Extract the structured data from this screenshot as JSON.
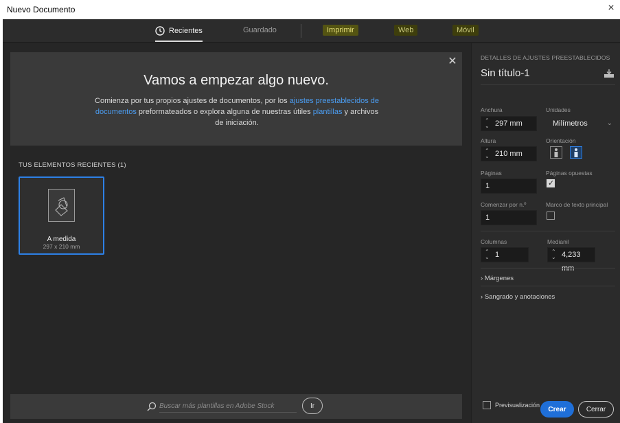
{
  "window": {
    "title": "Nuevo Documento",
    "close_glyph": "×"
  },
  "nav": {
    "tabs": [
      {
        "label": "Recientes"
      },
      {
        "label": "Guardado"
      },
      {
        "label": "Imprimir"
      },
      {
        "label": "Web"
      },
      {
        "label": "Móvil"
      }
    ]
  },
  "hero": {
    "title": "Vamos a empezar algo nuevo.",
    "text_1": "Comienza por tus propios ajustes de documentos, por los ",
    "link_1": "ajustes preestablecidos de documentos",
    "text_2": " preformateados o explora alguna de nuestras útiles ",
    "link_2": "plantillas",
    "text_3": " y archivos de iniciación.",
    "close_glyph": "✕"
  },
  "recent": {
    "label": "TUS ELEMENTOS RECIENTES  (1)",
    "items": [
      {
        "name": "A medida",
        "size": "297 x 210 mm"
      }
    ]
  },
  "search": {
    "placeholder": "Buscar más plantillas en Adobe Stock",
    "button": "Ir"
  },
  "panel": {
    "header": "DETALLES DE AJUSTES PREESTABLECIDOS",
    "doc_name": "Sin título-1",
    "width_label": "Anchura",
    "width_value": "297 mm",
    "units_label": "Unidades",
    "units_value": "Milímetros",
    "height_label": "Altura",
    "height_value": "210 mm",
    "orientation_label": "Orientación",
    "pages_label": "Páginas",
    "pages_value": "1",
    "facing_label": "Páginas opuestas",
    "start_label": "Comenzar por n.º",
    "start_value": "1",
    "master_frame_label": "Marco de texto principal",
    "columns_label": "Columnas",
    "columns_value": "1",
    "gutter_label": "Medianil",
    "gutter_value": "4,233 mm",
    "margins_label": "Márgenes",
    "bleed_label": "Sangrado y anotaciones",
    "facing_checked": true,
    "master_frame_checked": false
  },
  "footer": {
    "preview_label": "Previsualización",
    "create": "Crear",
    "close": "Cerrar"
  },
  "colors": {
    "accent": "#2d80e6",
    "link": "#4b9cf0",
    "create_button": "#1f6fd8"
  }
}
